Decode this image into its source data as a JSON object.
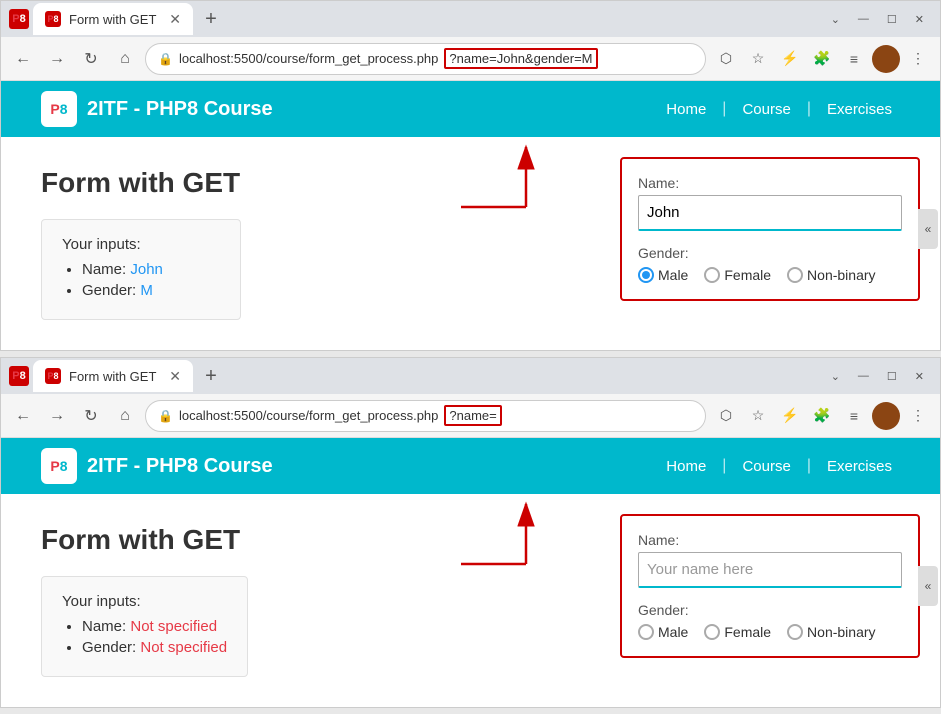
{
  "window1": {
    "title": "Form with GET",
    "url_before": "localhost:5500/course/form_get_process.php",
    "url_highlight": "?name=John&gender=M",
    "nav": {
      "home": "Home",
      "course": "Course",
      "exercises": "Exercises",
      "sep": "|"
    },
    "logo": "2ITF - PHP8 Course",
    "logo_badge": "P8",
    "page_title": "Form with GET",
    "inputs_label": "Your inputs:",
    "inputs": [
      {
        "key": "Name:",
        "value": "John",
        "value_class": "value-blue"
      },
      {
        "key": "Gender:",
        "value": "M",
        "value_class": "value-blue"
      }
    ],
    "form": {
      "name_label": "Name:",
      "name_value": "John",
      "name_placeholder": "",
      "gender_label": "Gender:",
      "gender_options": [
        {
          "label": "Male",
          "selected": true
        },
        {
          "label": "Female",
          "selected": false
        },
        {
          "label": "Non-binary",
          "selected": false
        }
      ]
    }
  },
  "window2": {
    "title": "Form with GET",
    "url_before": "localhost:5500/course/form_get_process.php",
    "url_highlight": "?name=",
    "nav": {
      "home": "Home",
      "course": "Course",
      "exercises": "Exercises",
      "sep": "|"
    },
    "logo": "2ITF - PHP8 Course",
    "logo_badge": "P8",
    "page_title": "Form with GET",
    "inputs_label": "Your inputs:",
    "inputs": [
      {
        "key": "Name:",
        "value": "Not specified",
        "value_class": "value-red"
      },
      {
        "key": "Gender:",
        "value": "Not specified",
        "value_class": "value-red"
      }
    ],
    "form": {
      "name_label": "Name:",
      "name_value": "",
      "name_placeholder": "Your name here",
      "gender_label": "Gender:",
      "gender_options": [
        {
          "label": "Male",
          "selected": false
        },
        {
          "label": "Female",
          "selected": false
        },
        {
          "label": "Non-binary",
          "selected": false
        }
      ]
    }
  }
}
